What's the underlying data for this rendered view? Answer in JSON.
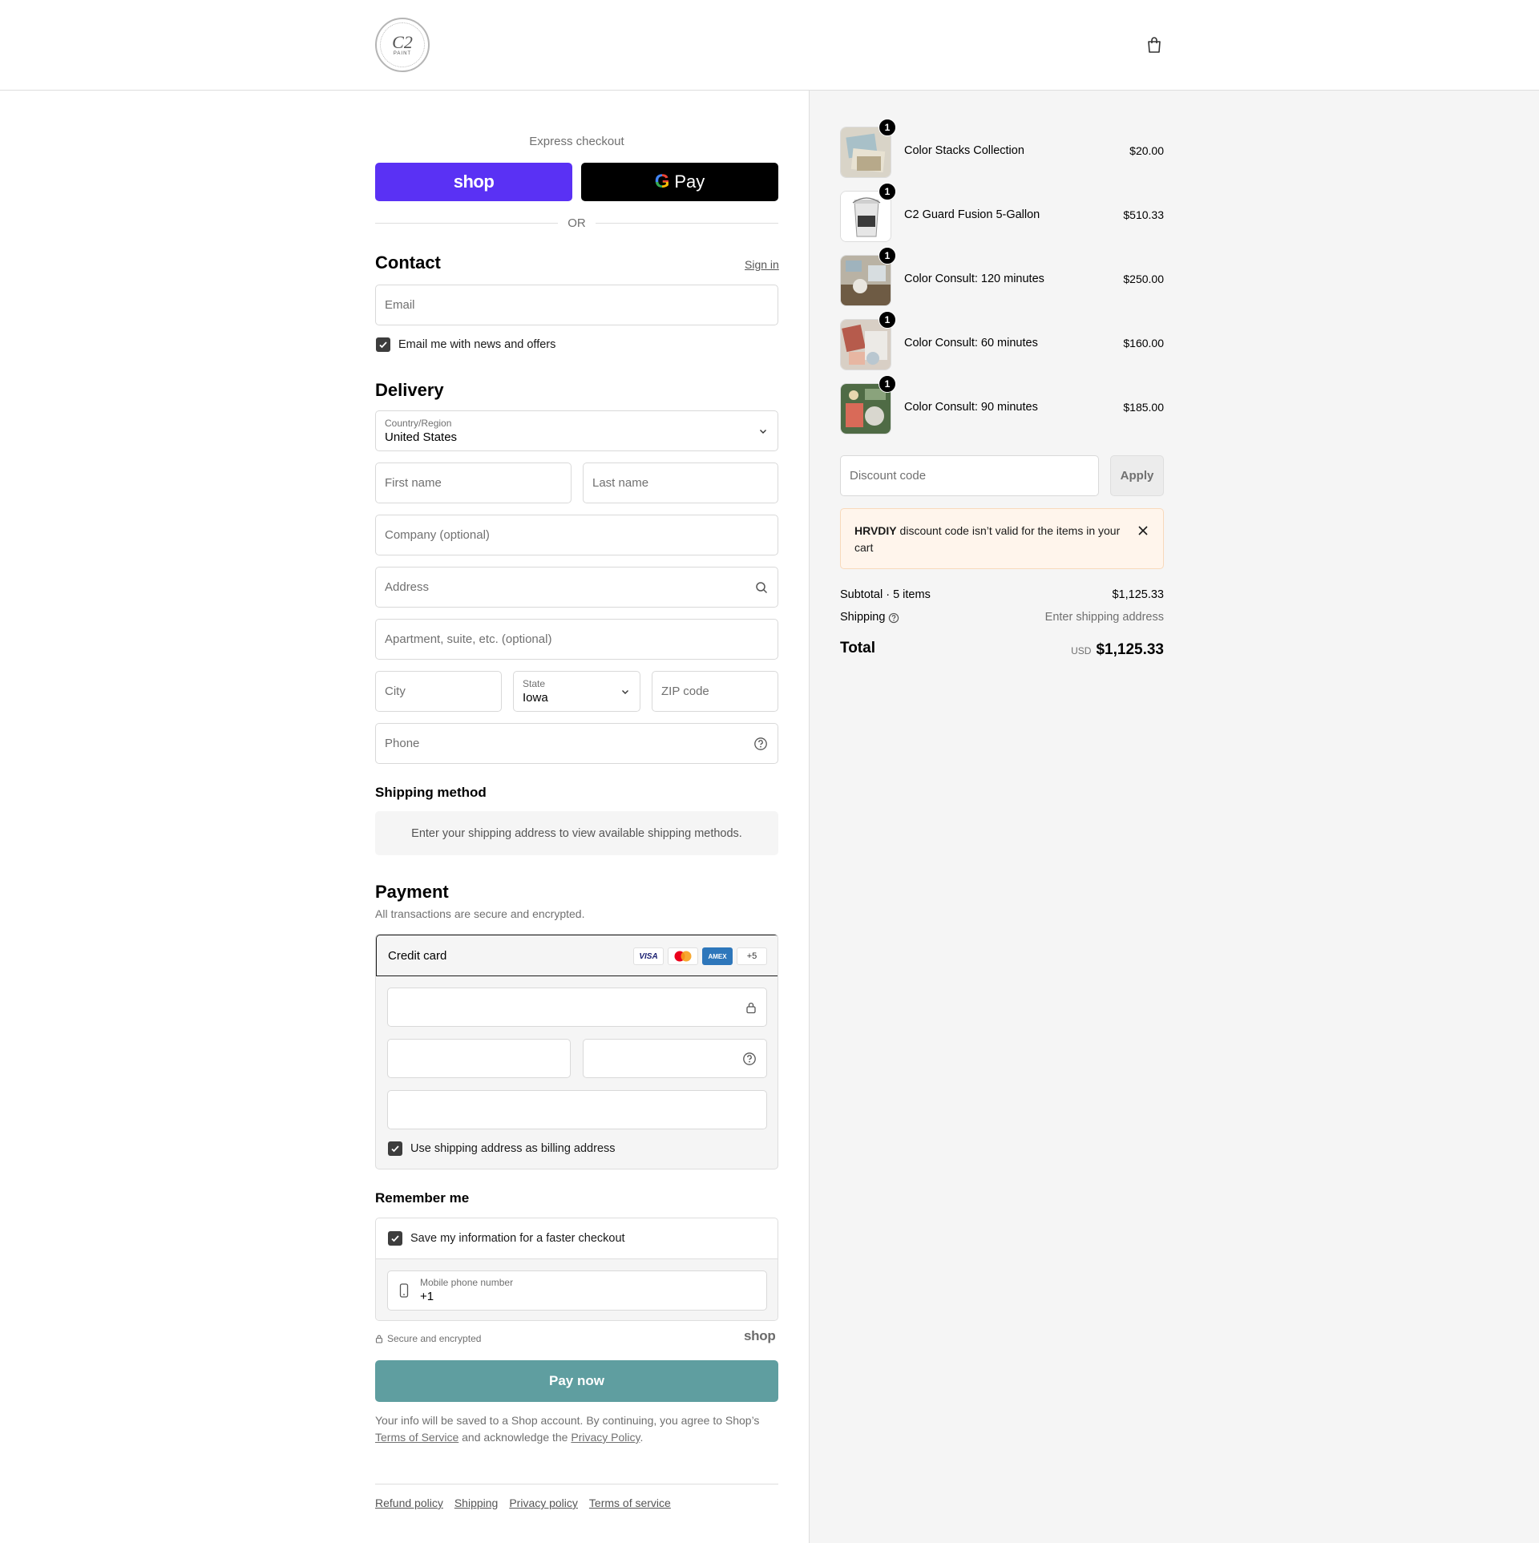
{
  "header": {
    "logo_mark": "C2",
    "logo_sub": "PAINT"
  },
  "express": {
    "label": "Express checkout",
    "shop_label": "shop",
    "gpay_g": "G",
    "gpay_label": "Pay",
    "or_label": "OR"
  },
  "contact": {
    "title": "Contact",
    "sign_in": "Sign in",
    "email_placeholder": "Email",
    "news_label": "Email me with news and offers"
  },
  "delivery": {
    "title": "Delivery",
    "country_label": "Country/Region",
    "country_value": "United States",
    "first_name": "First name",
    "last_name": "Last name",
    "company": "Company (optional)",
    "address": "Address",
    "apartment": "Apartment, suite, etc. (optional)",
    "city": "City",
    "state_label": "State",
    "state_value": "Iowa",
    "zip": "ZIP code",
    "phone": "Phone"
  },
  "shipping_method": {
    "title": "Shipping method",
    "note": "Enter your shipping address to view available shipping methods."
  },
  "payment": {
    "title": "Payment",
    "subtitle": "All transactions are secure and encrypted.",
    "credit_card": "Credit card",
    "cards": [
      "VISA",
      "AMEX",
      "+5"
    ],
    "billing_label": "Use shipping address as billing address"
  },
  "remember": {
    "title": "Remember me",
    "save_label": "Save my information for a faster checkout",
    "mobile_label": "Mobile phone number",
    "mobile_value": "+1",
    "secure": "Secure and encrypted",
    "shop_brand": "shop"
  },
  "pay_button": "Pay now",
  "legal": {
    "part1": "Your info will be saved to a Shop account. By continuing, you agree to Shop’s ",
    "tos": "Terms of Service",
    "part2": " and acknowledge the ",
    "privacy": "Privacy Policy",
    "part3": "."
  },
  "footer": [
    "Refund policy",
    "Shipping",
    "Privacy policy",
    "Terms of service"
  ],
  "cart": {
    "items": [
      {
        "name": "Color Stacks Collection",
        "price": "$20.00",
        "qty": "1"
      },
      {
        "name": "C2 Guard Fusion 5-Gallon",
        "price": "$510.33",
        "qty": "1"
      },
      {
        "name": "Color Consult: 120 minutes",
        "price": "$250.00",
        "qty": "1"
      },
      {
        "name": "Color Consult: 60 minutes",
        "price": "$160.00",
        "qty": "1"
      },
      {
        "name": "Color Consult: 90 minutes",
        "price": "$185.00",
        "qty": "1"
      }
    ],
    "discount_placeholder": "Discount code",
    "apply": "Apply",
    "alert_code": "HRVDIY",
    "alert_text": " discount code isn’t valid for the items in your cart",
    "subtotal_label": "Subtotal · 5 items",
    "subtotal_value": "$1,125.33",
    "shipping_label": "Shipping",
    "shipping_value": "Enter shipping address",
    "total_label": "Total",
    "currency": "USD",
    "total_value": "$1,125.33"
  },
  "colors": {
    "accent": "#5f9ea0",
    "shop_purple": "#5a31f4",
    "alert_bg": "#fff5ec"
  }
}
